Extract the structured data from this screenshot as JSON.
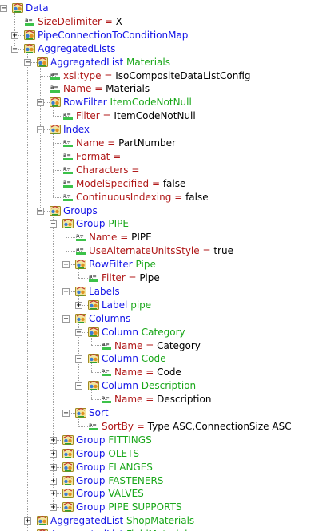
{
  "tree": [
    {
      "depth": 0,
      "kind": "node",
      "toggle": "minus",
      "name": "Data",
      "subtitle": "",
      "value": ""
    },
    {
      "depth": 1,
      "kind": "attr",
      "toggle": "",
      "name": "SizeDelimiter",
      "subtitle": "",
      "value": "X"
    },
    {
      "depth": 1,
      "kind": "node",
      "toggle": "plus",
      "name": "PipeConnectionToConditionMap",
      "subtitle": "",
      "value": ""
    },
    {
      "depth": 1,
      "kind": "node",
      "toggle": "minus",
      "name": "AggregatedLists",
      "subtitle": "",
      "value": ""
    },
    {
      "depth": 2,
      "kind": "node",
      "toggle": "minus",
      "name": "AggregatedList",
      "subtitle": "Materials",
      "value": ""
    },
    {
      "depth": 3,
      "kind": "attr",
      "toggle": "",
      "name": "xsi:type",
      "subtitle": "",
      "value": "IsoCompositeDataListConfig"
    },
    {
      "depth": 3,
      "kind": "attr",
      "toggle": "",
      "name": "Name",
      "subtitle": "",
      "value": "Materials"
    },
    {
      "depth": 3,
      "kind": "node",
      "toggle": "minus",
      "name": "RowFilter",
      "subtitle": "ItemCodeNotNull",
      "value": ""
    },
    {
      "depth": 4,
      "kind": "attr",
      "toggle": "",
      "name": "Filter",
      "subtitle": "",
      "value": "ItemCodeNotNull"
    },
    {
      "depth": 3,
      "kind": "node",
      "toggle": "minus",
      "name": "Index",
      "subtitle": "",
      "value": ""
    },
    {
      "depth": 4,
      "kind": "attr",
      "toggle": "",
      "name": "Name",
      "subtitle": "",
      "value": "PartNumber"
    },
    {
      "depth": 4,
      "kind": "attr",
      "toggle": "",
      "name": "Format",
      "subtitle": "",
      "value": ""
    },
    {
      "depth": 4,
      "kind": "attr",
      "toggle": "",
      "name": "Characters",
      "subtitle": "",
      "value": ""
    },
    {
      "depth": 4,
      "kind": "attr",
      "toggle": "",
      "name": "ModelSpecified",
      "subtitle": "",
      "value": "false"
    },
    {
      "depth": 4,
      "kind": "attr",
      "toggle": "",
      "name": "ContinuousIndexing",
      "subtitle": "",
      "value": "false"
    },
    {
      "depth": 3,
      "kind": "node",
      "toggle": "minus",
      "name": "Groups",
      "subtitle": "",
      "value": ""
    },
    {
      "depth": 4,
      "kind": "node",
      "toggle": "minus",
      "name": "Group",
      "subtitle": "PIPE",
      "value": ""
    },
    {
      "depth": 5,
      "kind": "attr",
      "toggle": "",
      "name": "Name",
      "subtitle": "",
      "value": "PIPE"
    },
    {
      "depth": 5,
      "kind": "attr",
      "toggle": "",
      "name": "UseAlternateUnitsStyle",
      "subtitle": "",
      "value": "true"
    },
    {
      "depth": 5,
      "kind": "node",
      "toggle": "minus",
      "name": "RowFilter",
      "subtitle": "Pipe",
      "value": ""
    },
    {
      "depth": 6,
      "kind": "attr",
      "toggle": "",
      "name": "Filter",
      "subtitle": "",
      "value": "Pipe"
    },
    {
      "depth": 5,
      "kind": "node",
      "toggle": "minus",
      "name": "Labels",
      "subtitle": "",
      "value": ""
    },
    {
      "depth": 6,
      "kind": "node",
      "toggle": "plus",
      "name": "Label",
      "subtitle": "pipe",
      "value": ""
    },
    {
      "depth": 5,
      "kind": "node",
      "toggle": "minus",
      "name": "Columns",
      "subtitle": "",
      "value": ""
    },
    {
      "depth": 6,
      "kind": "node",
      "toggle": "minus",
      "name": "Column",
      "subtitle": "Category",
      "value": ""
    },
    {
      "depth": 7,
      "kind": "attr",
      "toggle": "",
      "name": "Name",
      "subtitle": "",
      "value": "Category"
    },
    {
      "depth": 6,
      "kind": "node",
      "toggle": "minus",
      "name": "Column",
      "subtitle": "Code",
      "value": ""
    },
    {
      "depth": 7,
      "kind": "attr",
      "toggle": "",
      "name": "Name",
      "subtitle": "",
      "value": "Code"
    },
    {
      "depth": 6,
      "kind": "node",
      "toggle": "minus",
      "name": "Column",
      "subtitle": "Description",
      "value": ""
    },
    {
      "depth": 7,
      "kind": "attr",
      "toggle": "",
      "name": "Name",
      "subtitle": "",
      "value": "Description"
    },
    {
      "depth": 5,
      "kind": "node",
      "toggle": "minus",
      "name": "Sort",
      "subtitle": "",
      "value": ""
    },
    {
      "depth": 6,
      "kind": "attr",
      "toggle": "",
      "name": "SortBy",
      "subtitle": "",
      "value": "Type ASC,ConnectionSize ASC"
    },
    {
      "depth": 4,
      "kind": "node",
      "toggle": "plus",
      "name": "Group",
      "subtitle": "FITTINGS",
      "value": ""
    },
    {
      "depth": 4,
      "kind": "node",
      "toggle": "plus",
      "name": "Group",
      "subtitle": "OLETS",
      "value": ""
    },
    {
      "depth": 4,
      "kind": "node",
      "toggle": "plus",
      "name": "Group",
      "subtitle": "FLANGES",
      "value": ""
    },
    {
      "depth": 4,
      "kind": "node",
      "toggle": "plus",
      "name": "Group",
      "subtitle": "FASTENERS",
      "value": ""
    },
    {
      "depth": 4,
      "kind": "node",
      "toggle": "plus",
      "name": "Group",
      "subtitle": "VALVES",
      "value": ""
    },
    {
      "depth": 4,
      "kind": "node",
      "toggle": "plus",
      "name": "Group",
      "subtitle": "PIPE SUPPORTS",
      "value": ""
    },
    {
      "depth": 2,
      "kind": "node",
      "toggle": "plus",
      "name": "AggregatedList",
      "subtitle": "ShopMaterials",
      "value": ""
    },
    {
      "depth": 2,
      "kind": "node",
      "toggle": "plus",
      "name": "AggregatedList",
      "subtitle": "FieldMaterials",
      "value": ""
    }
  ],
  "icons": {
    "node": "xml-element-icon",
    "attr": "xml-attribute-icon",
    "expand": "expand-plus-icon",
    "collapse": "collapse-minus-icon"
  },
  "colors": {
    "node_name": "#1414e6",
    "subtitle": "#1aa71a",
    "attr_name": "#b01818",
    "value": "#000000",
    "equals": "#b01818"
  },
  "equals_sign": "="
}
